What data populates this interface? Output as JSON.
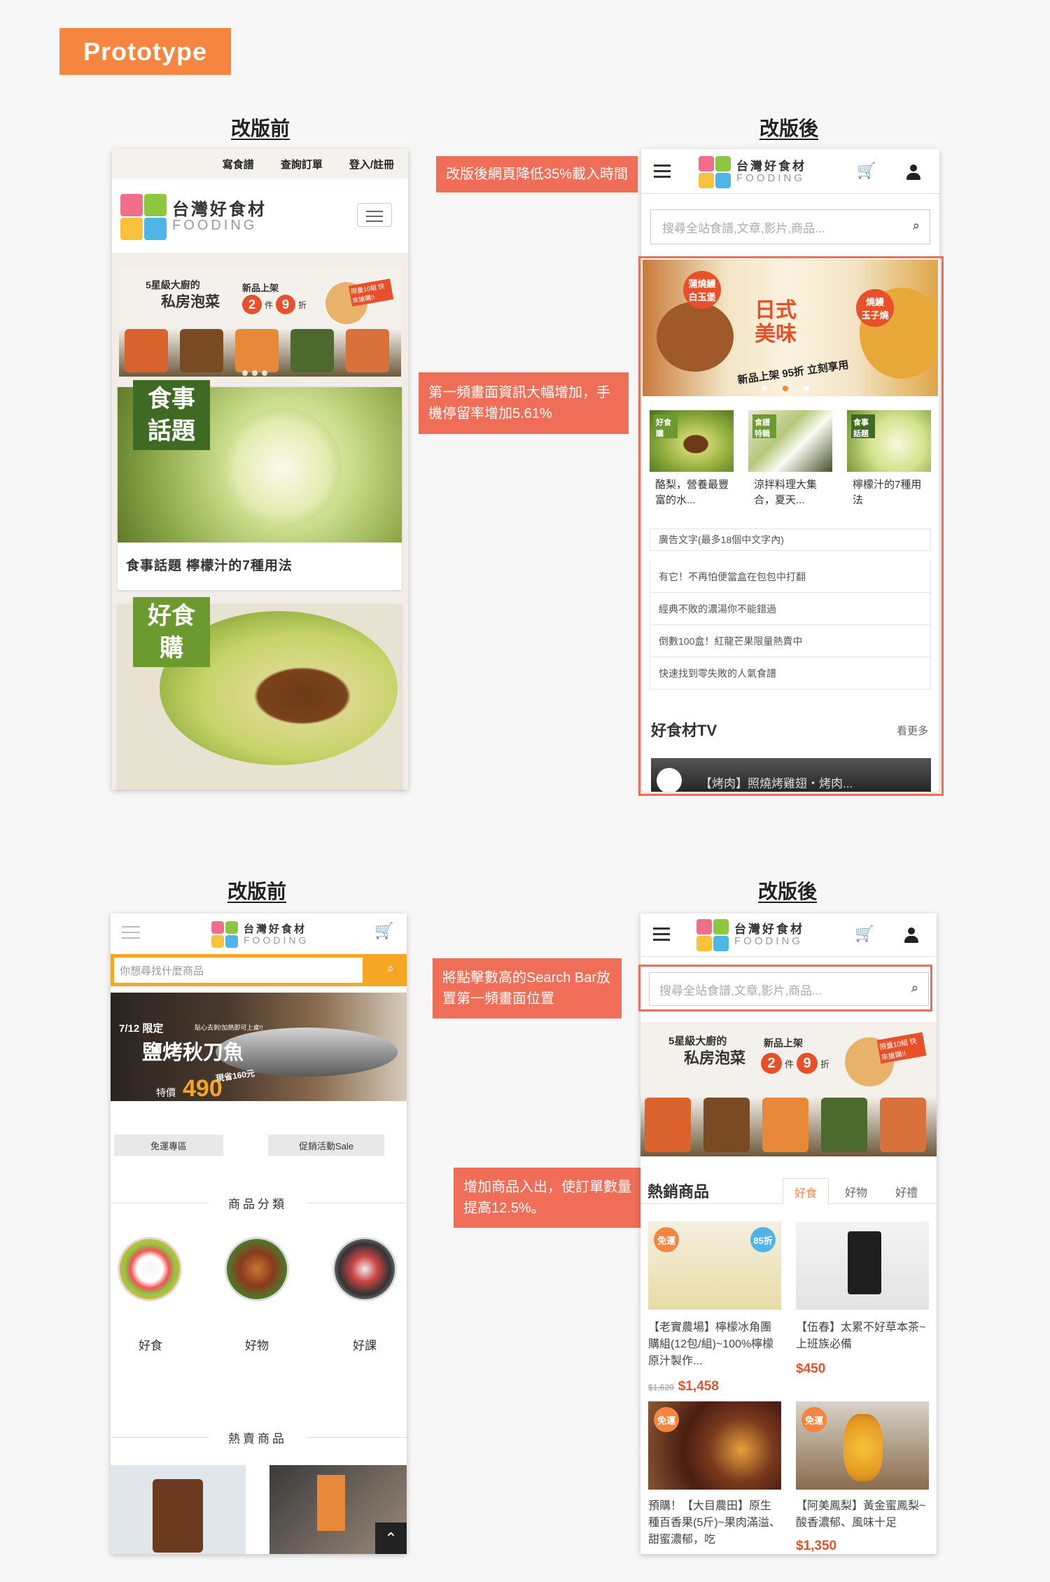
{
  "tag": "Prototype",
  "headings": {
    "before1": "改版前",
    "after1": "改版後",
    "before2": "改版前",
    "after2": "改版後"
  },
  "callouts": {
    "c1": "改版後網頁降低35%載入時間",
    "c2": "第一頻畫面資訊大幅增加，手機停留率增加5.61%",
    "c3": "將點擊數高的Search Bar放置第一頻畫面位置",
    "c4": "增加商品入出，使訂單數量提高12.5%。"
  },
  "logo": {
    "cn": "台灣好食材",
    "en": "FOODING"
  },
  "p1": {
    "topnav": [
      "寫食譜",
      "查詢訂單",
      "登入/註冊"
    ],
    "banner": {
      "top": "5星級大廚的",
      "main": "私房泡菜",
      "new": "新品上架",
      "deal_a": "2",
      "deal_mid": "件",
      "deal_b": "9",
      "deal_end": "折",
      "limit": "限量10組 快來搶購!!"
    },
    "card1": {
      "tag1": "食事",
      "tag2": "話題",
      "title": "食事話題 檸檬汁的7種用法"
    },
    "card2": {
      "tag1": "好食",
      "tag2": "購"
    }
  },
  "p2": {
    "search_placeholder": "搜尋全站食譜,文章,影片,商品...",
    "banner": {
      "left1": "蒲燒鰻",
      "left2": "白玉堡",
      "mid1": "日式",
      "mid2": "美味",
      "right1": "燒鰻",
      "right2": "玉子燒",
      "bottom": "新品上架 95折 立刻享用"
    },
    "tiles": [
      {
        "badge": "好食購",
        "text": "酪梨，營養最豐富的水..."
      },
      {
        "badge": "食譜特輯",
        "text": "涼拌料理大集合，夏天..."
      },
      {
        "badge": "食事話題",
        "text": "檸檬汁的7種用法"
      }
    ],
    "ads": [
      "廣告文字(最多18個中文字內)",
      "有它！不再怕便當盒在包包中打翻",
      "經典不敗的濃湯你不能錯過",
      "倒數100盒！紅龍芒果限量熱賣中",
      "快速找到零失敗的人氣食譜"
    ],
    "tv": {
      "title": "好食材TV",
      "more": "看更多",
      "video": "【烤肉】照燒烤雞翅・烤肉..."
    }
  },
  "p3": {
    "search_placeholder": "你想尋找什麼商品",
    "banner": {
      "date": "7/12 限定",
      "sub": "貼心去刺!加熱即可上桌!!",
      "title": "鹽烤秋刀魚",
      "special": "特價",
      "price": "490",
      "orig": "現省160元"
    },
    "btn1": "免運專區",
    "btn2": "促銷活動Sale",
    "cat_title": "商品分類",
    "cats": [
      "好食",
      "好物",
      "好課"
    ],
    "hot_title": "熱賣商品"
  },
  "p4": {
    "search_placeholder": "搜尋全站食譜,文章,影片,商品...",
    "hot": "熱銷商品",
    "tabs": [
      "好食",
      "好物",
      "好禮"
    ],
    "products": [
      {
        "badge": "免運",
        "discount": "85折",
        "title": "【老實農場】檸檬冰角團購組(12包/組)~100%檸檬原汁製作...",
        "old": "$1,620",
        "price": "$1,458"
      },
      {
        "title": "【伍春】太累不好草本茶~上班族必備",
        "price": "$450"
      },
      {
        "badge": "免運",
        "title": "預購！【大目農田】原生種百香果(5斤)~果肉滿溢、甜蜜濃郁，吃"
      },
      {
        "badge": "免運",
        "title": "【阿美鳳梨】黃金蜜鳳梨~酸香濃郁、風味十足",
        "price": "$1,350"
      }
    ]
  },
  "colors": {
    "accent": "#f5853f",
    "callout": "#f06e57",
    "price": "#e8502b"
  }
}
